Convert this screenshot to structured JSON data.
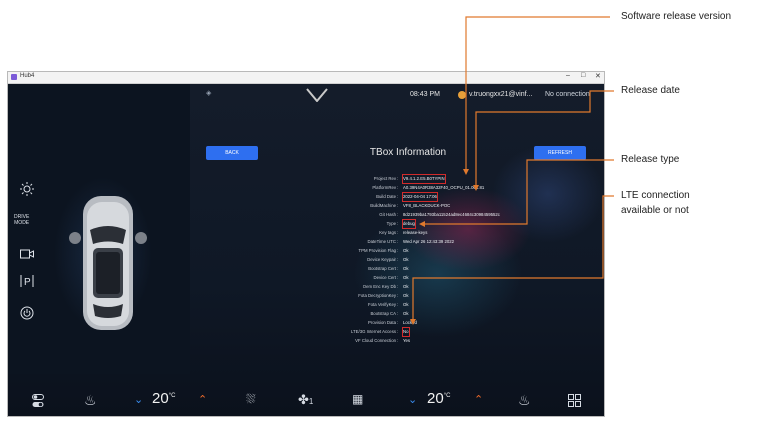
{
  "window": {
    "title": "Hub4",
    "controls": [
      "–",
      "□",
      "✕"
    ]
  },
  "status": {
    "time": "08:43 PM",
    "user": "v.truongxx21@vinf...",
    "connection": "No connection"
  },
  "page": {
    "title": "TBox Information",
    "back_label": "BACK",
    "refresh_label": "REFRESH"
  },
  "sidebar": {
    "drive_mode_label": "DRIVE\nMODE"
  },
  "info_rows": [
    {
      "label": "Project Rev",
      "value": "V9.4.1.2.E5.B0TYPIN"
    },
    {
      "label": "PlatformRev",
      "value": "A0.39N4A0R38A32F40_OCPU_01.001.81"
    },
    {
      "label": "Build Date",
      "value": "2022-04-04 17:06"
    },
    {
      "label": "BuildMachine",
      "value": "VF8_BLACKDUCK-POC"
    },
    {
      "label": "Git Hash",
      "value": "8d21939ba1793ba11524ad8ec4684c3098459552c"
    },
    {
      "label": "Type",
      "value": "debug"
    },
    {
      "label": "Key tags",
      "value": "release-keys"
    },
    {
      "label": "DateTime UTC",
      "value": "Wed Apr 26 12:43:39 2022"
    },
    {
      "label": "TPM Provision Flag",
      "value": "Ok"
    },
    {
      "label": "Device Keypair",
      "value": "Ok"
    },
    {
      "label": "Bootstrap Cert",
      "value": "Ok"
    },
    {
      "label": "Device Cert",
      "value": "Ok"
    },
    {
      "label": "Oem Enc Key Db",
      "value": "Ok"
    },
    {
      "label": "Fota DecryptionKey",
      "value": "Ok"
    },
    {
      "label": "Fota VerifyKey",
      "value": "Ok"
    },
    {
      "label": "Bootstrap CA",
      "value": "Ok"
    },
    {
      "label": "Provision Data",
      "value": "Locked"
    },
    {
      "label": "LTE/3G Internet Access",
      "value": "No"
    },
    {
      "label": "VF Cloud Connection",
      "value": "Yes"
    }
  ],
  "climate": {
    "left_temp": "20",
    "right_temp": "20",
    "unit": "°C",
    "fan_level": "1"
  },
  "annotations": {
    "software": "Software release version",
    "release_date": "Release date",
    "release_type": "Release type",
    "lte_line1": "LTE connection",
    "lte_line2": "available or not"
  },
  "colors": {
    "accent_button": "#2e6ff0",
    "annotation_line": "#e0792d",
    "highlight_box": "#d12b2b",
    "temp_up": "#f06a2a",
    "temp_down": "#3a8df0"
  }
}
